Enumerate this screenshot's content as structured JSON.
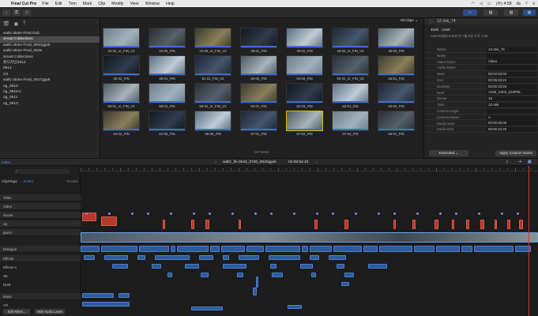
{
  "menubar": {
    "app": "Final Cut Pro",
    "items": [
      "File",
      "Edit",
      "Trim",
      "Mark",
      "Clip",
      "Modify",
      "View",
      "Window",
      "Help"
    ],
    "clock": "(수) 4:58",
    "user": "ds"
  },
  "library": {
    "items": [
      {
        "label": "waltz alone Final Dub",
        "sel": false
      },
      {
        "label": "Smart Collections",
        "sel": true
      },
      {
        "label": "waltz alone Final_0810ggok",
        "sel": false
      },
      {
        "label": "waltz alone Final_0815",
        "sel": false
      },
      {
        "label": "Smart Collections",
        "sel": false
      },
      {
        "label": "유디자인0914",
        "sel": false
      },
      {
        "label": "0914",
        "sel": false
      },
      {
        "label": "C0",
        "sel": false
      },
      {
        "label": "waltz alone Final_0817ggok",
        "sel": false
      },
      {
        "label": "og_0810",
        "sel": false
      },
      {
        "label": "og_0810-1",
        "sel": false
      },
      {
        "label": "og_0811",
        "sel": false
      },
      {
        "label": "og_0813",
        "sel": false
      }
    ]
  },
  "browser": {
    "filter": "All Clips ⌄",
    "count": "157 Items",
    "rows": [
      [
        "44-04_re_FIN_V2",
        "44-05_FIN",
        "44-05_re_FIN_V2",
        "45-01_FIN",
        "45-02_FIN",
        "45-02_re_FIN_V2",
        "45-03_FIN"
      ],
      [
        "46-02_FIN",
        "48-01_FIN",
        "51-01_FIN_V2",
        "52-02_FIN",
        "54-02_FIN",
        "55-01_re_FIN_V2",
        "55-01_FIN"
      ],
      [
        "58-01_re_FIN_V2",
        "58-02_FIN",
        "58-02_re_FIN_V2",
        "62-01_FIN",
        "62-03_FIN",
        "63-01_FIN",
        "63-02_FIN"
      ],
      [
        "64-02_FIN",
        "64-05_FIN",
        "65-06_FIN",
        "67-01_FIN",
        "67-02_FIN",
        "67-04_FIN",
        "68-01_FIN"
      ]
    ]
  },
  "inspector": {
    "clip_name": "12-2ek_74",
    "timecode": "4040 · 2160",
    "last_modified": "Last Modified 2017년 7월 6일 오후 1:48",
    "rows": [
      {
        "k": "Name",
        "v": "12-2ek_74"
      },
      {
        "k": "Notes",
        "v": ""
      },
      {
        "k": "Video Roles",
        "v": "Video"
      },
      {
        "k": "Audio Roles",
        "v": ""
      },
      {
        "k": "Start",
        "v": "00:04:53:03"
      },
      {
        "k": "End",
        "v": "00:05:03:23"
      },
      {
        "k": "Duration",
        "v": "00:00:10:20"
      },
      {
        "k": "Reel",
        "v": "A040_C004_010PRL"
      },
      {
        "k": "Scene",
        "v": "16"
      },
      {
        "k": "Take",
        "v": "12-2ek"
      },
      {
        "k": "Camera Angle",
        "v": ""
      },
      {
        "k": "Camera Name",
        "v": "A"
      },
      {
        "k": "Media Start",
        "v": "00:00:00:00"
      },
      {
        "k": "Media End",
        "v": "00:00:10:20"
      }
    ],
    "extended": "Extended ⌄",
    "apply": "Apply Custom Name"
  },
  "timeline_bar": {
    "index_label": "Index",
    "project": "waltz_fin 0544_0730_0810ggok",
    "timecode": "01:05:54:19"
  },
  "tindex": {
    "tabs": [
      "Clips",
      "Tags",
      "Roles"
    ],
    "count": "70 roles",
    "rows": [
      "Titles",
      "Video",
      "Scene",
      "og",
      "gaoni",
      "Dialogue",
      "Effects",
      "Effects-1",
      "SE",
      "DUB",
      "Music",
      "VO"
    ],
    "edit_roles": "Edit Roles...",
    "hide_audio": "Hide Audio Lanes"
  }
}
